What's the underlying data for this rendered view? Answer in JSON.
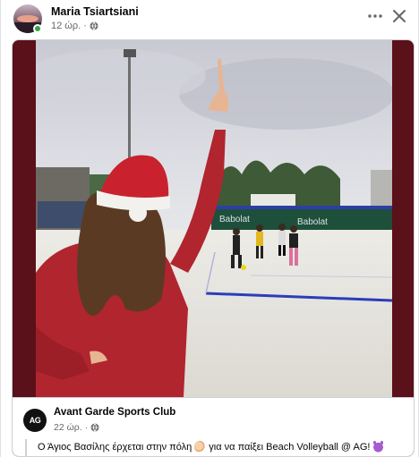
{
  "post": {
    "author": "Maria Tsiartsiani",
    "time": "12 ώρ.",
    "separator": "·"
  },
  "shared": {
    "page_name": "Avant Garde Sports Club",
    "logo_text": "AG",
    "time": "22 ώρ.",
    "separator": "·",
    "caption_part1": "Ο Άγιος Βασίλης έρχεται στην πόλη",
    "caption_part2": "για να παίξει Beach Volleyball @ AG!"
  },
  "icons": {
    "more": "more-horizontal-icon",
    "close": "close-icon",
    "privacy": "globe-icon"
  },
  "colors": {
    "frame_background": "#5a1119",
    "online": "#31a24c",
    "meta_text": "#65676b"
  }
}
